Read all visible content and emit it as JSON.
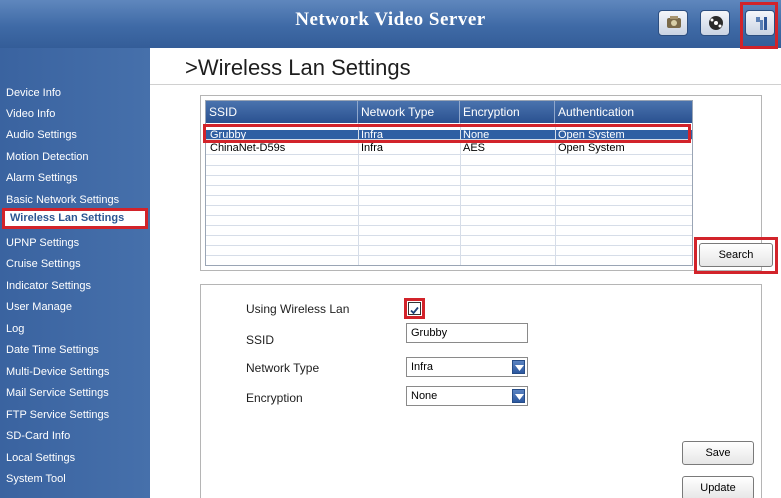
{
  "header": {
    "title": "Network Video Server"
  },
  "sidebar": {
    "items": [
      {
        "label": "Device Info"
      },
      {
        "label": "Video Info"
      },
      {
        "label": "Audio Settings"
      },
      {
        "label": "Motion Detection"
      },
      {
        "label": "Alarm Settings"
      },
      {
        "label": "Basic Network Settings"
      },
      {
        "label": "Wireless Lan Settings",
        "active": true
      },
      {
        "label": "UPNP Settings"
      },
      {
        "label": "Cruise Settings"
      },
      {
        "label": "Indicator Settings"
      },
      {
        "label": "User Manage"
      },
      {
        "label": "Log"
      },
      {
        "label": "Date Time Settings"
      },
      {
        "label": "Multi-Device Settings"
      },
      {
        "label": "Mail Service Settings"
      },
      {
        "label": "FTP Service Settings"
      },
      {
        "label": "SD-Card Info"
      },
      {
        "label": "Local Settings"
      },
      {
        "label": "System Tool"
      }
    ]
  },
  "page": {
    "title": ">Wireless Lan Settings"
  },
  "wifi_table": {
    "columns": [
      "SSID",
      "Network Type",
      "Encryption",
      "Authentication"
    ],
    "rows": [
      {
        "ssid": "Grubby",
        "network_type": "Infra",
        "encryption": "None",
        "authentication": "Open System",
        "selected": true
      },
      {
        "ssid": "ChinaNet-D59s",
        "network_type": "Infra",
        "encryption": "AES",
        "authentication": "Open System",
        "selected": false
      }
    ]
  },
  "buttons": {
    "search": "Search",
    "save": "Save",
    "update": "Update"
  },
  "form": {
    "using_wireless_label": "Using Wireless Lan",
    "using_wireless_checked": true,
    "ssid_label": "SSID",
    "ssid_value": "Grubby",
    "network_type_label": "Network Type",
    "network_type_value": "Infra",
    "encryption_label": "Encryption",
    "encryption_value": "None"
  },
  "colors": {
    "header": "#3f6aa6",
    "sidebar": "#4670ab",
    "highlight": "#d2232a",
    "selected_row": "#2f5fa3"
  },
  "icons": [
    "video-icon",
    "playback-icon",
    "settings-tool-icon",
    "checkmark-icon",
    "dropdown-arrow-icon"
  ]
}
